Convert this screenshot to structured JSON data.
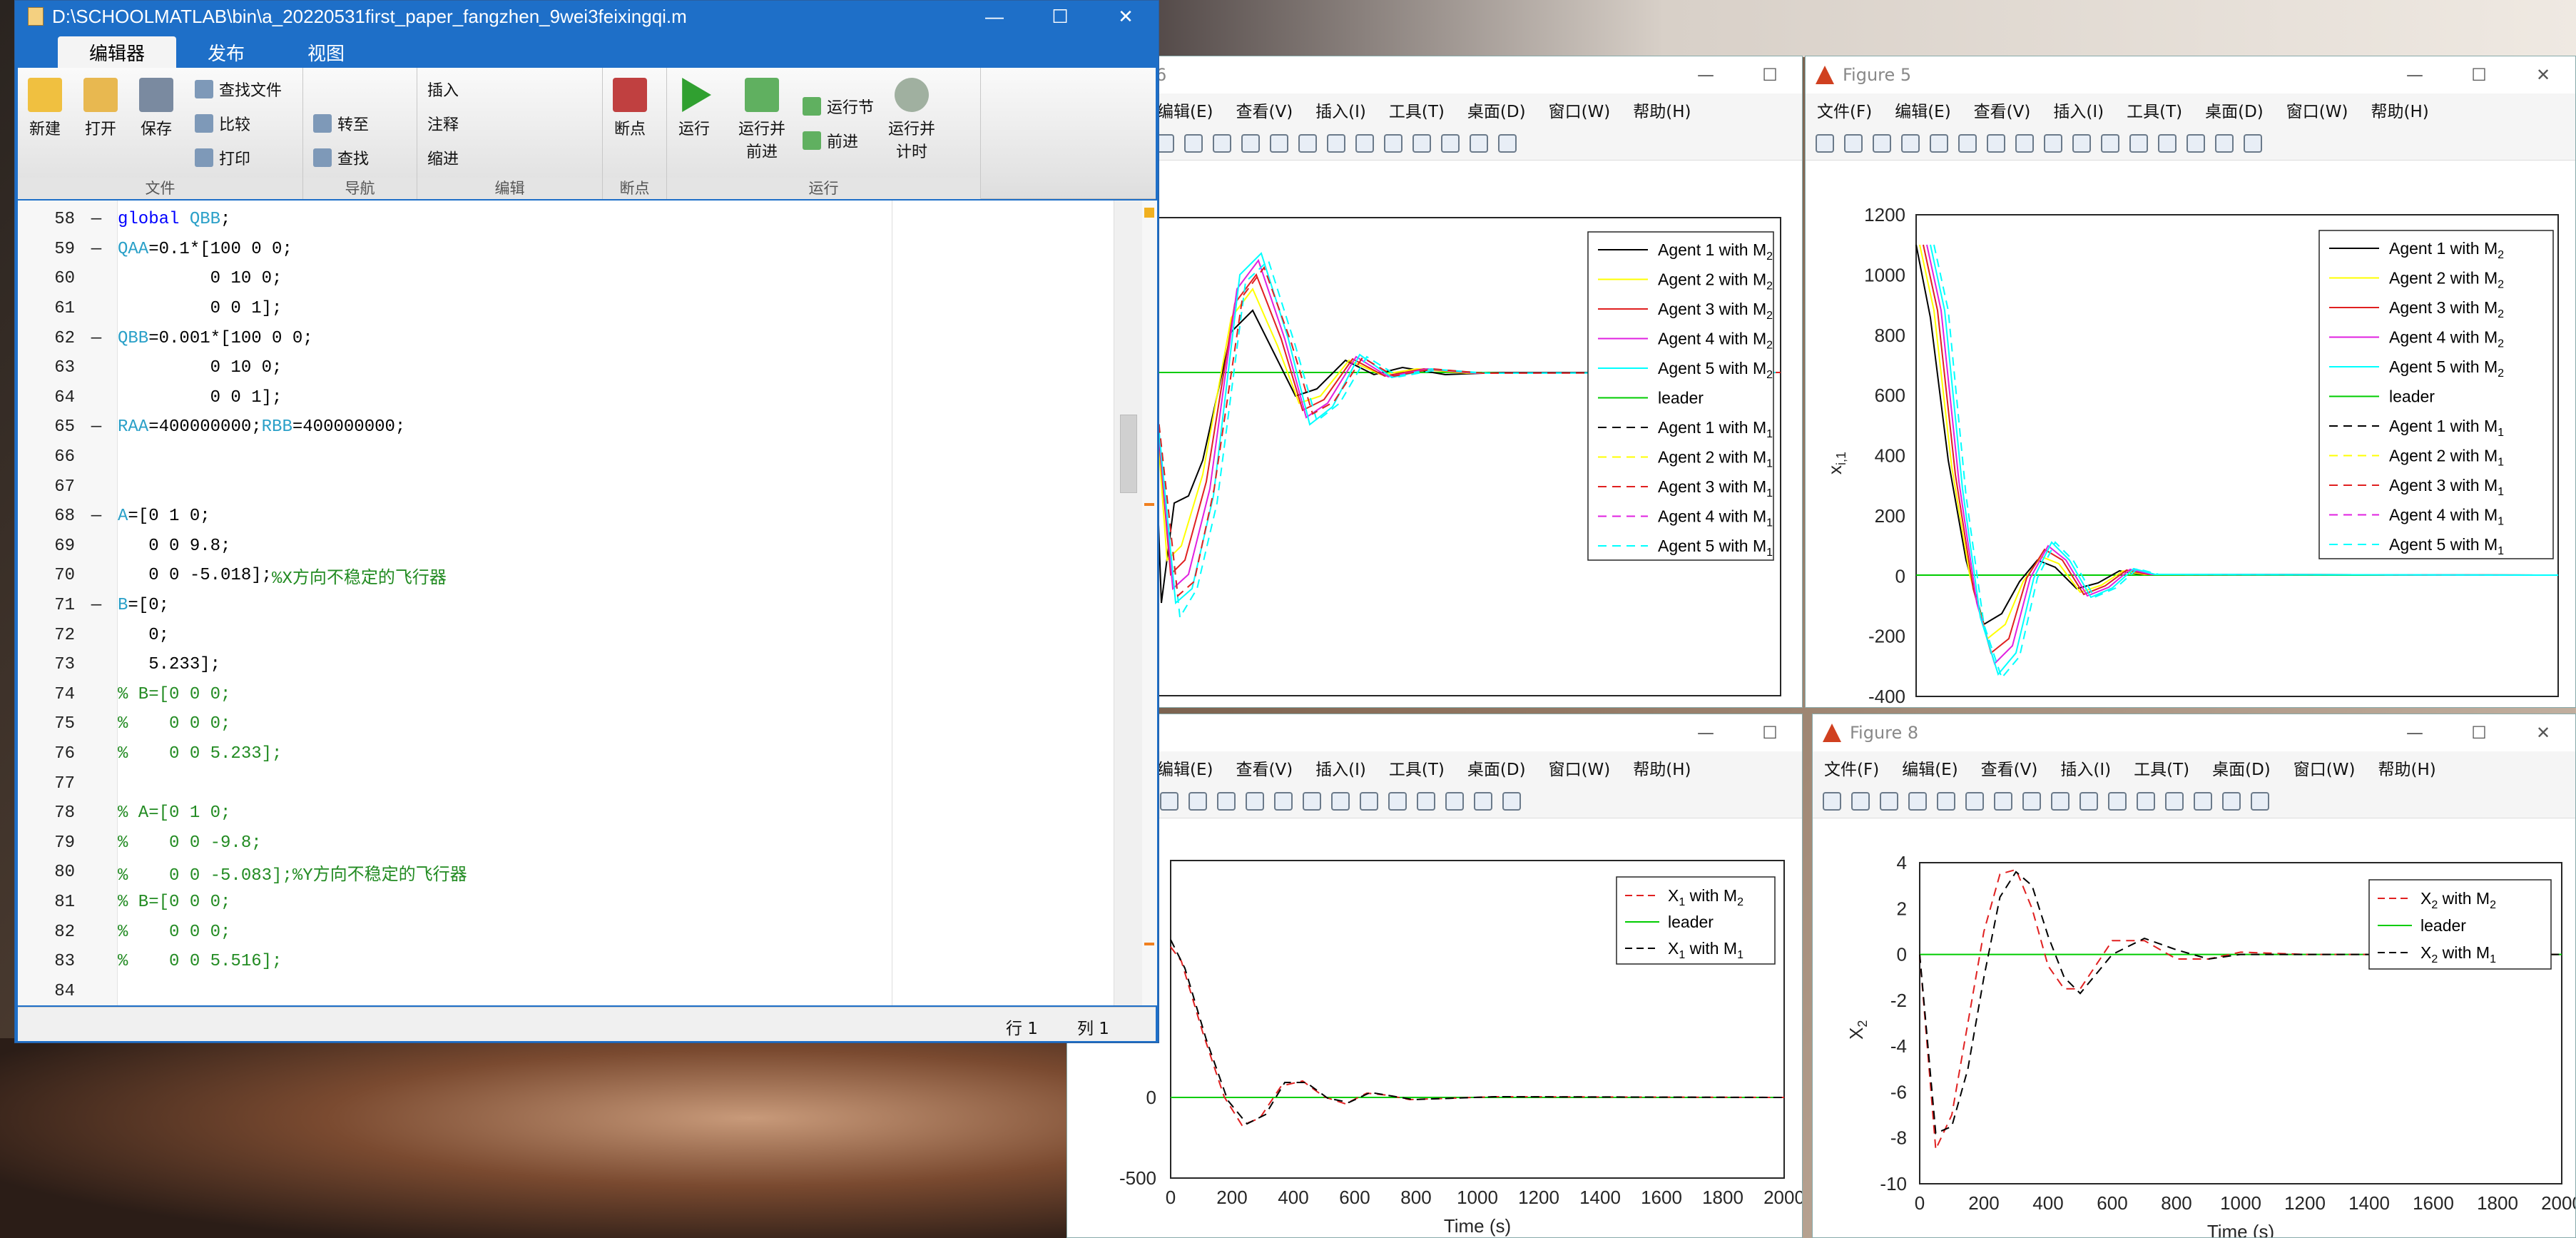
{
  "editor": {
    "title": "D:\\SCHOOLMATLAB\\bin\\a_20220531first_paper_fangzhen_9wei3feixingqi.m",
    "tabs": [
      "编辑器",
      "发布",
      "视图"
    ],
    "ribbon": {
      "new": "新建",
      "open": "打开",
      "save": "保存",
      "find_files": "查找文件",
      "compare": "比较",
      "print": "打印",
      "goto": "转至",
      "find": "查找",
      "insert": "插入",
      "comment": "注释",
      "indent": "缩进",
      "breakpoints": "断点",
      "run": "运行",
      "run_advance_1": "运行并",
      "run_advance_2": "前进",
      "run_section": "运行节",
      "advance": "前进",
      "run_time_1": "运行并",
      "run_time_2": "计时",
      "groups": [
        "文件",
        "导航",
        "编辑",
        "断点",
        "运行"
      ]
    },
    "lines": [
      {
        "n": "58",
        "d": "—",
        "parts": [
          [
            "kw",
            "global "
          ],
          [
            "vr",
            "QBB"
          ],
          [
            "txt",
            ";"
          ]
        ]
      },
      {
        "n": "59",
        "d": "—",
        "parts": [
          [
            "vr",
            "QAA"
          ],
          [
            "txt",
            "=0.1*[100 0 0;"
          ]
        ]
      },
      {
        "n": "60",
        "d": "",
        "parts": [
          [
            "txt",
            "         0 10 0;"
          ]
        ]
      },
      {
        "n": "61",
        "d": "",
        "parts": [
          [
            "txt",
            "         0 0 1];"
          ]
        ]
      },
      {
        "n": "62",
        "d": "—",
        "parts": [
          [
            "vr",
            "QBB"
          ],
          [
            "txt",
            "=0.001*[100 0 0;"
          ]
        ]
      },
      {
        "n": "63",
        "d": "",
        "parts": [
          [
            "txt",
            "         0 10 0;"
          ]
        ]
      },
      {
        "n": "64",
        "d": "",
        "parts": [
          [
            "txt",
            "         0 0 1];"
          ]
        ]
      },
      {
        "n": "65",
        "d": "—",
        "parts": [
          [
            "vr",
            "RAA"
          ],
          [
            "txt",
            "=400000000;"
          ],
          [
            "vr",
            "RBB"
          ],
          [
            "txt",
            "=400000000;"
          ]
        ]
      },
      {
        "n": "66",
        "d": "",
        "parts": []
      },
      {
        "n": "67",
        "d": "",
        "parts": []
      },
      {
        "n": "68",
        "d": "—",
        "parts": [
          [
            "vr",
            "A"
          ],
          [
            "txt",
            "=[0 1 0;"
          ]
        ]
      },
      {
        "n": "69",
        "d": "",
        "parts": [
          [
            "txt",
            "   0 0 9.8;"
          ]
        ]
      },
      {
        "n": "70",
        "d": "",
        "parts": [
          [
            "txt",
            "   0 0 -5.018];"
          ],
          [
            "cm",
            "%X方向不稳定的飞行器"
          ]
        ]
      },
      {
        "n": "71",
        "d": "—",
        "parts": [
          [
            "vr",
            "B"
          ],
          [
            "txt",
            "=[0;"
          ]
        ]
      },
      {
        "n": "72",
        "d": "",
        "parts": [
          [
            "txt",
            "   0;"
          ]
        ]
      },
      {
        "n": "73",
        "d": "",
        "parts": [
          [
            "txt",
            "   5.233];"
          ]
        ]
      },
      {
        "n": "74",
        "d": "",
        "parts": [
          [
            "cm",
            "% B=[0 0 0;"
          ]
        ]
      },
      {
        "n": "75",
        "d": "",
        "parts": [
          [
            "cm",
            "%    0 0 0;"
          ]
        ]
      },
      {
        "n": "76",
        "d": "",
        "parts": [
          [
            "cm",
            "%    0 0 5.233];"
          ]
        ]
      },
      {
        "n": "77",
        "d": "",
        "parts": []
      },
      {
        "n": "78",
        "d": "",
        "parts": [
          [
            "cm",
            "% A=[0 1 0;"
          ]
        ]
      },
      {
        "n": "79",
        "d": "",
        "parts": [
          [
            "cm",
            "%    0 0 -9.8;"
          ]
        ]
      },
      {
        "n": "80",
        "d": "",
        "parts": [
          [
            "cm",
            "%    0 0 -5.083];%Y方向不稳定的飞行器"
          ]
        ]
      },
      {
        "n": "81",
        "d": "",
        "parts": [
          [
            "cm",
            "% B=[0 0 0;"
          ]
        ]
      },
      {
        "n": "82",
        "d": "",
        "parts": [
          [
            "cm",
            "%    0 0 0;"
          ]
        ]
      },
      {
        "n": "83",
        "d": "",
        "parts": [
          [
            "cm",
            "%    0 0 5.516];"
          ]
        ]
      },
      {
        "n": "84",
        "d": "",
        "parts": []
      }
    ],
    "status": {
      "row": "行  1",
      "col": "列  1"
    }
  },
  "figure_menu": [
    "文件(F)",
    "编辑(E)",
    "查看(V)",
    "插入(I)",
    "工具(T)",
    "桌面(D)",
    "窗口(W)",
    "帮助(H)"
  ],
  "figures": {
    "f6_title": "6",
    "f5_title": "Figure 5",
    "f7_title": "",
    "f8_title": "Figure 8",
    "f7_xlabel": "Time (s)",
    "f8_xlabel": "Time (s)",
    "f5_ylabel": "x",
    "f8_ylabel": "X"
  },
  "colors": {
    "c1": "#000000",
    "c2": "#ffff00",
    "c3": "#e02020",
    "c4": "#e020e0",
    "c5": "#00ffff",
    "leader": "#00cc00"
  },
  "chart_data": [
    {
      "type": "line",
      "title": "",
      "note": "Figure 6 (partially visible, y tick labels cut)",
      "legend": [
        "Agent 1 with M2",
        "Agent 2 with M2",
        "Agent 3 with M2",
        "Agent 4 with M2",
        "Agent 5 with M2",
        "leader",
        "Agent 1 with M1",
        "Agent 2 with M1",
        "Agent 3 with M1",
        "Agent 4 with M1",
        "Agent 5 with M1"
      ],
      "legend_position": "top-right"
    },
    {
      "type": "line",
      "title": "",
      "ylabel": "x_{i,1}",
      "ylim": [
        -400,
        1200
      ],
      "yticks": [
        "1200",
        "1000",
        "800",
        "600",
        "400",
        "200",
        "0",
        "-200",
        "-400"
      ],
      "legend": [
        "Agent 1 with M2",
        "Agent 2 with M2",
        "Agent 3 with M2",
        "Agent 4 with M2",
        "Agent 5 with M2",
        "leader",
        "Agent 1 with M1",
        "Agent 2 with M1",
        "Agent 3 with M1",
        "Agent 4 with M1",
        "Agent 5 with M1"
      ],
      "legend_position": "top-right",
      "x": [
        0,
        50,
        100,
        150,
        200,
        250,
        300,
        350,
        400,
        450,
        500,
        550,
        600,
        650,
        700,
        800,
        900,
        1000,
        1200,
        1400,
        1600,
        1800,
        2000
      ],
      "series_sample": {
        "name": "Agent 1 with M2",
        "values": [
          1100,
          800,
          350,
          0,
          -150,
          -140,
          -60,
          20,
          60,
          40,
          -10,
          -40,
          -30,
          0,
          20,
          10,
          0,
          0,
          0,
          0,
          0,
          0,
          0
        ]
      }
    },
    {
      "type": "line",
      "xlabel": "Time (s)",
      "xlim": [
        0,
        2000
      ],
      "xticks": [
        "0",
        "200",
        "400",
        "600",
        "800",
        "1000",
        "1200",
        "1400",
        "1600",
        "1800",
        "2000"
      ],
      "yticks": [
        "0",
        "-500"
      ],
      "legend": [
        "X1 with M2",
        "leader",
        "X1 with M1"
      ],
      "legend_position": "top-right"
    },
    {
      "type": "line",
      "xlabel": "Time (s)",
      "ylabel": "X_2",
      "xlim": [
        0,
        2000
      ],
      "ylim": [
        -10,
        4
      ],
      "xticks": [
        "0",
        "200",
        "400",
        "600",
        "800",
        "1000",
        "1200",
        "1400",
        "1600",
        "1800",
        "2000"
      ],
      "yticks": [
        "4",
        "2",
        "0",
        "-2",
        "-4",
        "-6",
        "-8",
        "-10"
      ],
      "legend": [
        "X2 with M2",
        "leader",
        "X2 with M1"
      ],
      "legend_position": "top-right",
      "x": [
        0,
        50,
        100,
        150,
        200,
        250,
        300,
        350,
        400,
        450,
        500,
        600,
        700,
        800,
        900,
        1000,
        1200,
        1600,
        2000
      ],
      "series": [
        {
          "name": "X2 with M2",
          "values": [
            0,
            -8.5,
            -7,
            -3,
            1,
            3.5,
            3.7,
            2,
            -0.5,
            -1.5,
            -1.5,
            0.6,
            0.6,
            -0.2,
            -0.2,
            0.1,
            0,
            0,
            0
          ]
        },
        {
          "name": "X2 with M1",
          "values": [
            0,
            -7.8,
            -7.5,
            -5,
            -1,
            2.5,
            3.6,
            3,
            0.8,
            -1,
            -1.7,
            0,
            0.7,
            0.2,
            -0.2,
            0,
            0,
            0,
            0
          ]
        }
      ]
    }
  ]
}
